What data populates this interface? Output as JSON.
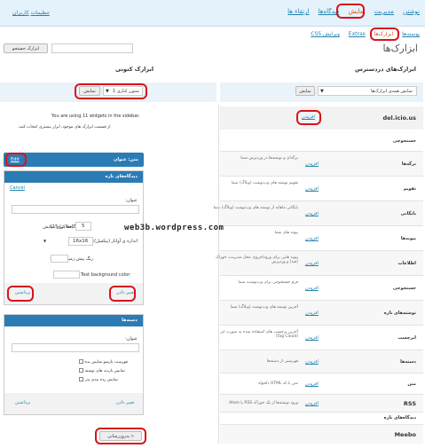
{
  "nav": {
    "main": [
      "نوشتن",
      "مدیریت",
      "نمایش",
      "دیدگاه‌ها",
      "ارتقاء ها"
    ],
    "right": [
      "تنظیمات",
      "کاربران"
    ],
    "sub": [
      "پوسته‌ها",
      "ابزارک‌ها",
      "Extras",
      "ویرایش CSS"
    ]
  },
  "page": {
    "title": "ابزارک‌ها",
    "search_button": "ابزارک جستجو",
    "available_title": "ابزارک‌های دردسترس",
    "current_title": "ابزارک کنونی",
    "show_filter": "نمایش همه‌ی ابزارک‌ها",
    "show_button": "نمایش",
    "sidebar_select": "ستون کناری 1",
    "sidebar_show_button": "نمایش"
  },
  "widgets_list": [
    {
      "name": "del.icio.us",
      "add": "افزودن",
      "desc": ""
    },
    {
      "name": "جستجوچی",
      "add": "",
      "desc": ""
    },
    {
      "name": "برگه‌ها",
      "add": "افزودن",
      "desc": "برگه‌ای و نوشته‌ها در وردپرس شما"
    },
    {
      "name": "تقویم",
      "add": "افزودن",
      "desc": "تقویم نوشته های وب‌نوشت (وبلاگ) شما"
    },
    {
      "name": "بایگانی",
      "add": "افزودن",
      "desc": "بایگانی ماهانه از نوشته های وب‌نوشت (وبلاگ) شما"
    },
    {
      "name": "پیوندها",
      "add": "افزودن",
      "desc": "پیوند های شما"
    },
    {
      "name": "اطلاعات",
      "add": "افزودن",
      "desc": "پیوند هایی برای ورود/خروج، محل مدیریت، خوراک (فید) و وردپرس"
    },
    {
      "name": "جستجوچی",
      "add": "افزودن",
      "desc": "فرم جستجوچی برای وب‌نوشت شما"
    },
    {
      "name": "نوشته‌های تازه",
      "add": "افزودن",
      "desc": "آخرین نوشته های وب‌نوشت (وبلاگ) شما"
    },
    {
      "name": "ابرچسب",
      "add": "افزودن",
      "desc": "آخرین برچسب های استفاده شده به صورت ابر (Tag Cloud)"
    },
    {
      "name": "دسته‌ها",
      "add": "افزودن",
      "desc": "فهرستی از دسته‌ها"
    },
    {
      "name": "متن",
      "add": "افزودن",
      "desc": "متن یا کد HTML دلخواه"
    },
    {
      "name": "RSS",
      "add": "افزودن",
      "desc": "ورود نوشته‌ها از یک خوراک RSS یا Atom"
    },
    {
      "name": "دیدگاه‌های تازه",
      "add": "",
      "desc": ""
    },
    {
      "name": "Meebo",
      "add": "",
      "desc": ""
    }
  ],
  "sidebar": {
    "usage_text": "You are using 11 widgets in the sidebar.",
    "usage_hint": "از قسمت ابزارک های موجود، ابزار بیشتری انتخاب کنید.",
    "text_widget": {
      "title": "متن: عنوان",
      "edit": "Edit"
    },
    "recent_comments": {
      "title": "دیدگاه‌های تازه",
      "cancel": "Cancel",
      "field_title": "عنوان:",
      "count_label": "تعداد دیدگاه‌ها برای نمایش",
      "count_value": "5",
      "count_hint": "(حداکثر 15)",
      "avatar_label": "اندازه ی آواتار (پیکسل):",
      "avatar_value": "16x16",
      "bg_label": "رنگ پیش زمینه شناسه:",
      "text_bg_label": "Text background color:",
      "change": "تغییر دادن",
      "remove": "برداشتن"
    },
    "categories": {
      "title": "دسته‌ها",
      "cancel": "Cancel",
      "field_title": "عنوان:",
      "options": [
        "فهرست بازشو نمایش بده",
        "نمایش بازدید های نوشته",
        "نمایش رده بندی پدر"
      ],
      "change": "تغییر دادن",
      "remove": "برداشتن"
    },
    "save_button": "به‌روزرسانی »"
  },
  "watermark": "web3b.wordpress.com"
}
